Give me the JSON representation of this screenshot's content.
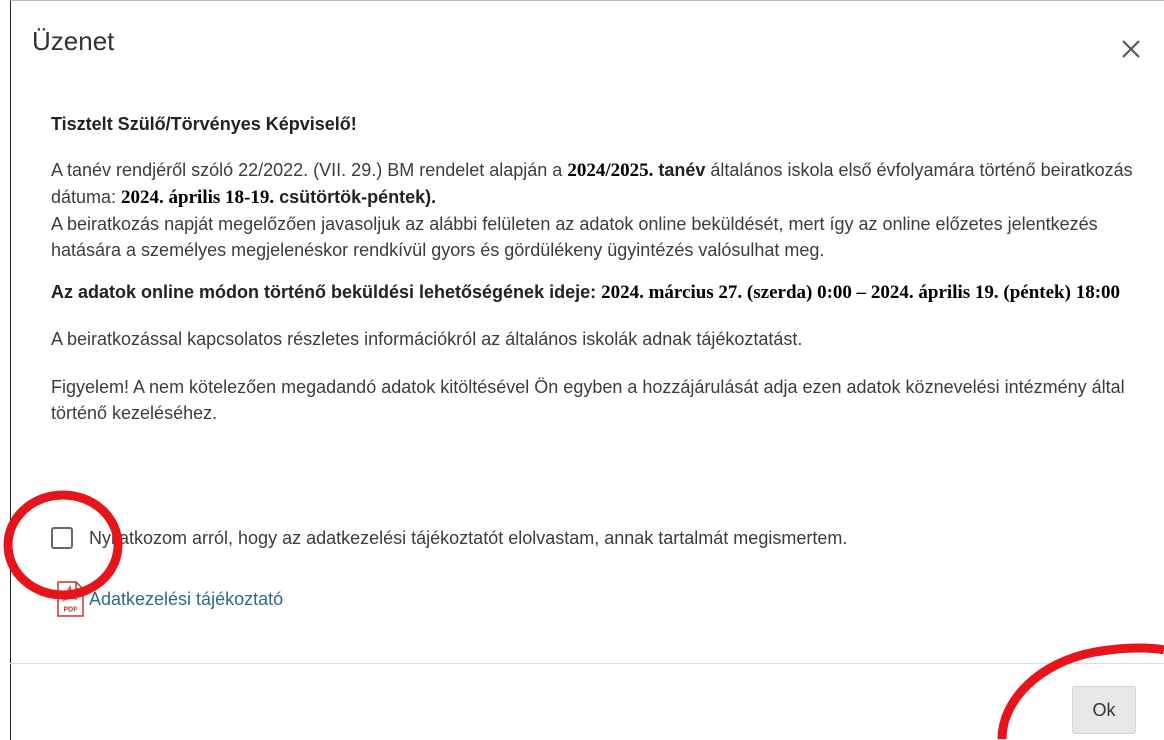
{
  "dialog": {
    "title": "Üzenet",
    "close_icon": "close-icon",
    "greeting": "Tisztelt Szülő/Törvényes Képviselő!",
    "para1": {
      "t1": "A tanév rendjéről szóló 22/2022. (VII. 29.) BM rendelet alapján a ",
      "year": "2024/2025.",
      "t2": " tanév",
      "t3": " általános iskola első évfolyamára történő beiratkozás dátuma: ",
      "date": "2024. április 18-19.",
      "days": " csütörtök-péntek).",
      "t4": "A beiratkozás napját megelőzően javasoljuk az alábbi felületen az adatok online beküldését, mert így az online előzetes jelentkezés hatására a személyes megjelenéskor rendkívül gyors és gördülékeny ügyintézés valósulhat meg."
    },
    "para2": {
      "label": "Az adatok online módon történő beküldési lehetőségének ideje: ",
      "period": "2024. március 27. (szerda) 0:00 – 2024. április 19. (péntek) 18:00"
    },
    "para3": "A beiratkozással kapcsolatos részletes információkról az általános iskolák adnak tájékoztatást.",
    "para4": "Figyelem! A nem kötelezően megadandó adatok kitöltésével Ön egyben a hozzájárulását adja ezen adatok köznevelési intézmény által történő kezeléséhez.",
    "checkbox_label": "Nyilatkozom arról, hogy az adatkezelési tájékoztatót elolvastam, annak tartalmát megismertem.",
    "checkbox_checked": false,
    "pdf_icon": "pdf-icon",
    "pdf_badge": "PDF",
    "pdf_link": "Adatkezelési tájékoztató",
    "ok_label": "Ok"
  },
  "colors": {
    "link": "#2f6a86",
    "annotation": "#e8141b",
    "button_bg": "#e8e8e8"
  }
}
